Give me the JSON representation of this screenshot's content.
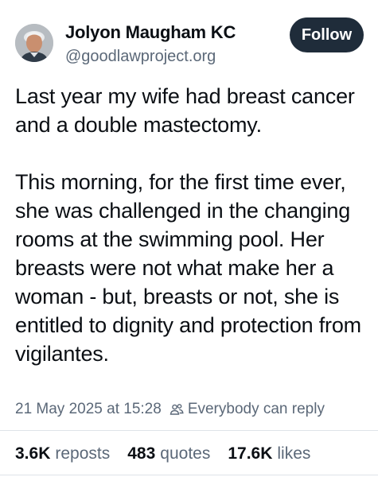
{
  "author": {
    "name": "Jolyon Maugham KC",
    "handle": "@goodlawproject.org",
    "avatar_icon": "profile-photo"
  },
  "follow_label": "Follow",
  "post": {
    "paragraph_1": "Last year my wife had breast cancer and a double mastectomy.",
    "paragraph_2": "This morning, for the first time ever, she was challenged in the changing rooms at the swimming pool. Her breasts were not what make her a woman - but, breasts or not, she is entitled to dignity and protection from vigilantes."
  },
  "meta": {
    "timestamp": "21 May 2025 at 15:28",
    "reply_setting": "Everybody can reply",
    "reply_icon": "people-icon"
  },
  "stats": {
    "reposts_count": "3.6K",
    "reposts_label": "reposts",
    "quotes_count": "483",
    "quotes_label": "quotes",
    "likes_count": "17.6K",
    "likes_label": "likes"
  },
  "colors": {
    "text": "#0b0f14",
    "muted": "#5b6878",
    "follow_bg": "#1f2c3a",
    "divider": "#dfe3e8"
  }
}
